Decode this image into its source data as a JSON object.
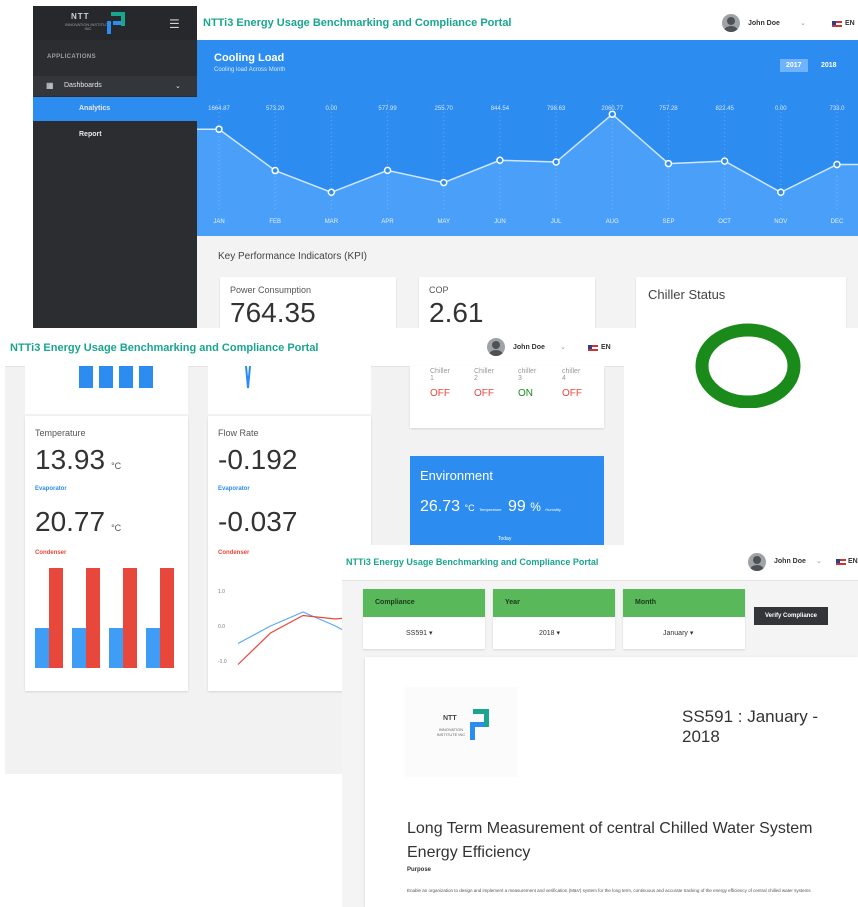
{
  "colors": {
    "teal": "#1aa58f",
    "blue": "#2d8cf0",
    "orange": "#e8483b",
    "green": "#1a8a1a",
    "panel_green": "#58b85a",
    "sidebar": "#2b2d31"
  },
  "portal_title": "NTTi3 Energy Usage Benchmarking and Compliance Portal",
  "user": {
    "name": "John Doe",
    "lang": "EN"
  },
  "logo": {
    "name": "NTT",
    "sub": "INNOVATION INSTITUTE INC"
  },
  "sidebar": {
    "section": "APPLICATIONS",
    "group": "Dashboards",
    "items": [
      {
        "label": "Analytics"
      },
      {
        "label": "Report"
      }
    ]
  },
  "cooling": {
    "title": "Cooling Load",
    "subtitle": "Cooling load Across Month",
    "years": [
      "2017",
      "2018"
    ]
  },
  "chart_data": {
    "type": "area",
    "title": "Cooling Load",
    "subtitle": "Cooling load Across Month",
    "categories": [
      "JAN",
      "FEB",
      "MAR",
      "APR",
      "MAY",
      "JUN",
      "JUL",
      "AUG",
      "SEP",
      "OCT",
      "NOV",
      "DEC"
    ],
    "value_labels": [
      "1664.87",
      "573.20",
      "0.00",
      "577.99",
      "255.70",
      "844.54",
      "798.63",
      "2060.77",
      "757.28",
      "822.45",
      "0.00",
      "733.0"
    ],
    "values": [
      1664.87,
      573.2,
      0,
      577.99,
      255.7,
      844.54,
      798.63,
      2060.77,
      757.28,
      822.45,
      0,
      733.0
    ],
    "ylim": [
      -600,
      2700
    ]
  },
  "kpi": {
    "title": "Key Performance Indicators (KPI)",
    "power": {
      "label": "Power Consumption",
      "value": "764.35"
    },
    "cop": {
      "label": "COP",
      "value": "2.61"
    },
    "chiller_status": {
      "label": "Chiller Status"
    }
  },
  "chillers": [
    {
      "name": "Chiller",
      "num": "1",
      "state": "OFF"
    },
    {
      "name": "Chiller",
      "num": "2",
      "state": "OFF"
    },
    {
      "name": "chiller",
      "num": "3",
      "state": "ON"
    },
    {
      "name": "chiller",
      "num": "4",
      "state": "OFF"
    }
  ],
  "temperature": {
    "label": "Temperature",
    "evap": "13.93",
    "evap_label": "Evaporator",
    "cond": "20.77",
    "cond_label": "Condenser",
    "unit": "°C",
    "bars_evap": [
      0.4,
      0.4,
      0.4,
      0.4
    ],
    "bars_cond": [
      1.0,
      1.0,
      1.0,
      1.0
    ]
  },
  "flow": {
    "label": "Flow Rate",
    "evap": "-0.192",
    "evap_label": "Evaporator",
    "cond": "-0.037",
    "cond_label": "Condenser",
    "ticks": [
      "1.0",
      "0.0",
      "-1.0"
    ],
    "blue_line": [
      -0.5,
      0.0,
      0.4,
      0.0,
      -0.5
    ],
    "red_line": [
      -1.1,
      -0.2,
      0.3,
      0.2,
      0.3
    ]
  },
  "environment": {
    "title": "Environment",
    "temp": "26.73",
    "temp_unit": "°C",
    "temp_label": "Temperature",
    "hum": "99",
    "hum_unit": "%",
    "hum_label": "Humidity",
    "footer": "Today"
  },
  "compliance": {
    "filters": [
      {
        "label": "Compliance",
        "value": "SS591"
      },
      {
        "label": "Year",
        "value": "2018"
      },
      {
        "label": "Month",
        "value": "January"
      }
    ],
    "verify": "Verify Compliance",
    "heading": "SS591 : January - 2018",
    "doc_title": "Long Term Measurement of central Chilled Water System Energy Efficiency",
    "purpose": "Purpose",
    "paragraph": "Enable an organization to design and implement a measurement and verification (M&V) system for the long term, continuous and accurate tracking of the energy efficiency of central chilled water systems"
  }
}
